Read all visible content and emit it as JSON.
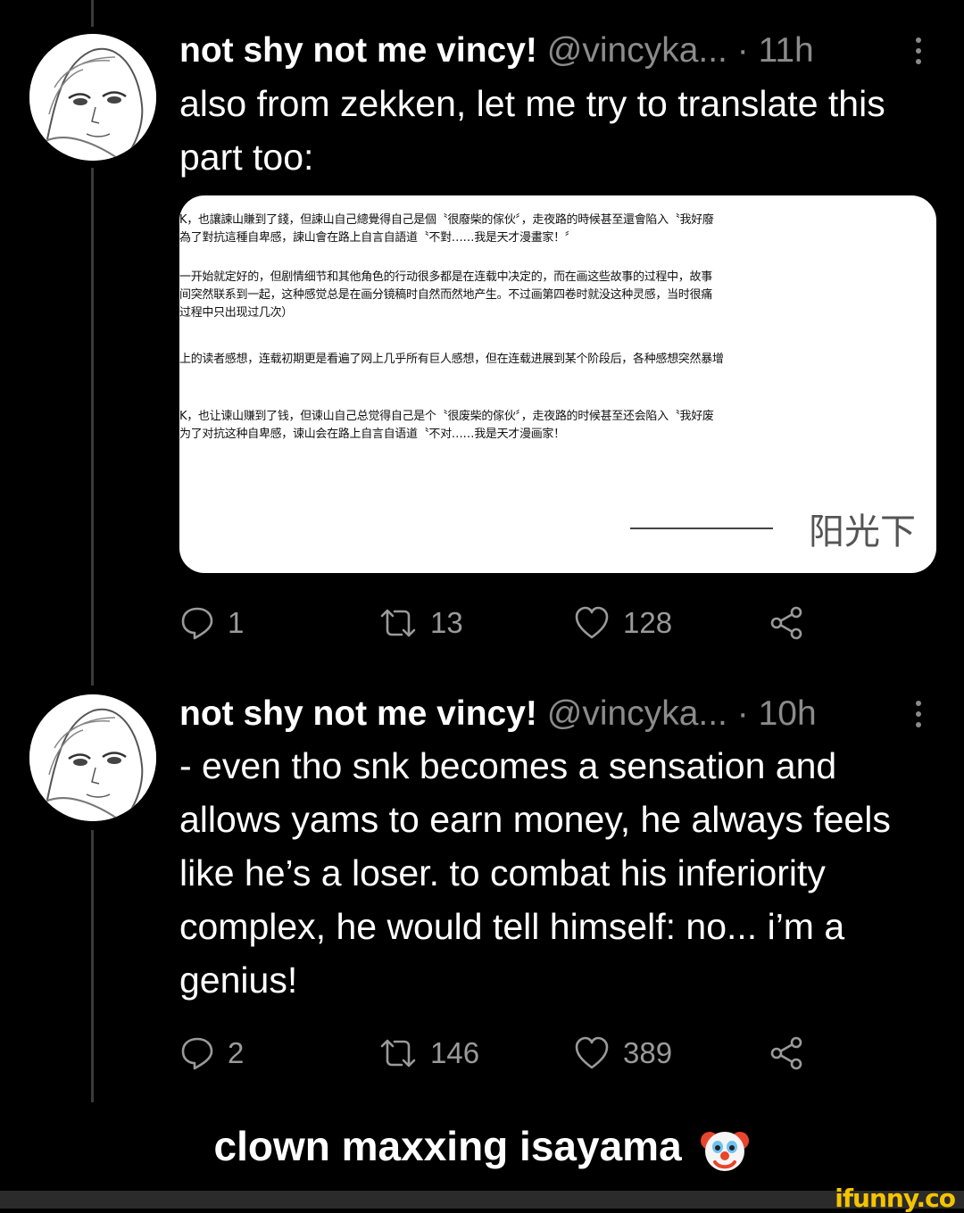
{
  "tweets": [
    {
      "author_name": "not shy not me vincy!",
      "handle": "@vincyka...",
      "time": "· 11h",
      "text": "also from zekken, let me try to translate this part too:",
      "media": {
        "block1": [
          "K，也讓諫山賺到了錢，但諫山自己總覺得自己是個〝很廢柴的傢伙〞，走夜路的時候甚至還會陷入〝我好廢",
          "為了對抗這種自卑感，諫山會在路上自言自語道〝不對……我是天才漫畫家！〞"
        ],
        "block2": [
          "一开始就定好的，但剧情细节和其他角色的行动很多都是在连载中决定的，而在画这些故事的过程中，故事",
          "间突然联系到一起，这种感觉总是在画分镜稿时自然而然地产生。不过画第四卷时就没这种灵感，当时很痛",
          "过程中只出现过几次）"
        ],
        "block3": [
          "上的读者感想，连载初期更是看遍了网上几乎所有巨人感想，但在连载进展到某个阶段后，各种感想突然暴增"
        ],
        "block4": [
          "K，也让谏山赚到了钱，但谏山自己总觉得自己是个〝很废柴的傢伙〞，走夜路的时候甚至还会陷入〝我好废",
          "为了对抗这种自卑感，谏山会在路上自言自语道〝不对……我是天才漫画家！"
        ],
        "signature": "阳光下"
      },
      "stats": {
        "replies": "1",
        "retweets": "13",
        "likes": "128"
      }
    },
    {
      "author_name": "not shy not me vincy!",
      "handle": "@vincyka...",
      "time": "· 10h",
      "text": "- even tho snk becomes a sensation and allows yams to earn money, he always feels like he’s a loser. to combat his inferiority complex, he would tell himself: no... i’m a genius!",
      "stats": {
        "replies": "2",
        "retweets": "146",
        "likes": "389"
      }
    }
  ],
  "caption": "clown maxxing isayama",
  "caption_emoji": "clown-face-icon",
  "brand": "ifunny.co",
  "colors": {
    "background": "#000000",
    "muted": "#8b8b8b",
    "brand": "#f5c400"
  }
}
